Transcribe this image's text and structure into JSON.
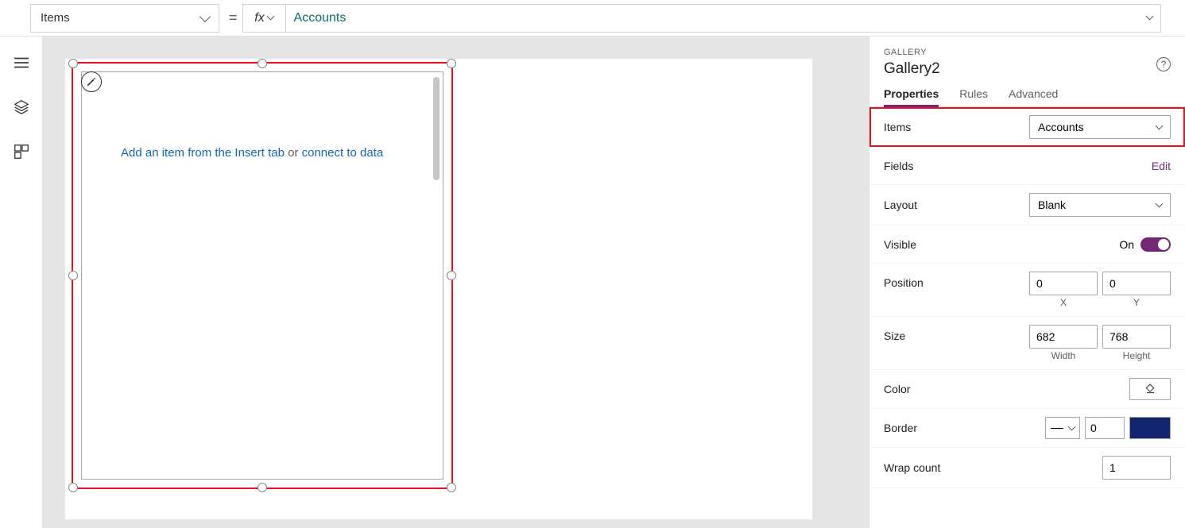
{
  "formulaBar": {
    "propertySelected": "Items",
    "fxLabel": "fx",
    "formula": "Accounts"
  },
  "canvas": {
    "galleryHint": {
      "prefix": "Add an item from the Insert tab",
      "middle": " or ",
      "suffix": "connect to data"
    },
    "editTooltip": "Edit"
  },
  "panel": {
    "typeLabel": "GALLERY",
    "name": "Gallery2",
    "tabs": {
      "properties": "Properties",
      "rules": "Rules",
      "advanced": "Advanced"
    },
    "items": {
      "label": "Items",
      "value": "Accounts"
    },
    "fields": {
      "label": "Fields",
      "edit": "Edit"
    },
    "layout": {
      "label": "Layout",
      "value": "Blank"
    },
    "visible": {
      "label": "Visible",
      "state": "On"
    },
    "position": {
      "label": "Position",
      "x": "0",
      "y": "0",
      "xLabel": "X",
      "yLabel": "Y"
    },
    "size": {
      "label": "Size",
      "w": "682",
      "h": "768",
      "wLabel": "Width",
      "hLabel": "Height"
    },
    "color": {
      "label": "Color"
    },
    "border": {
      "label": "Border",
      "width": "0",
      "colorHex": "#11256e"
    },
    "wrap": {
      "label": "Wrap count",
      "value": "1"
    }
  }
}
